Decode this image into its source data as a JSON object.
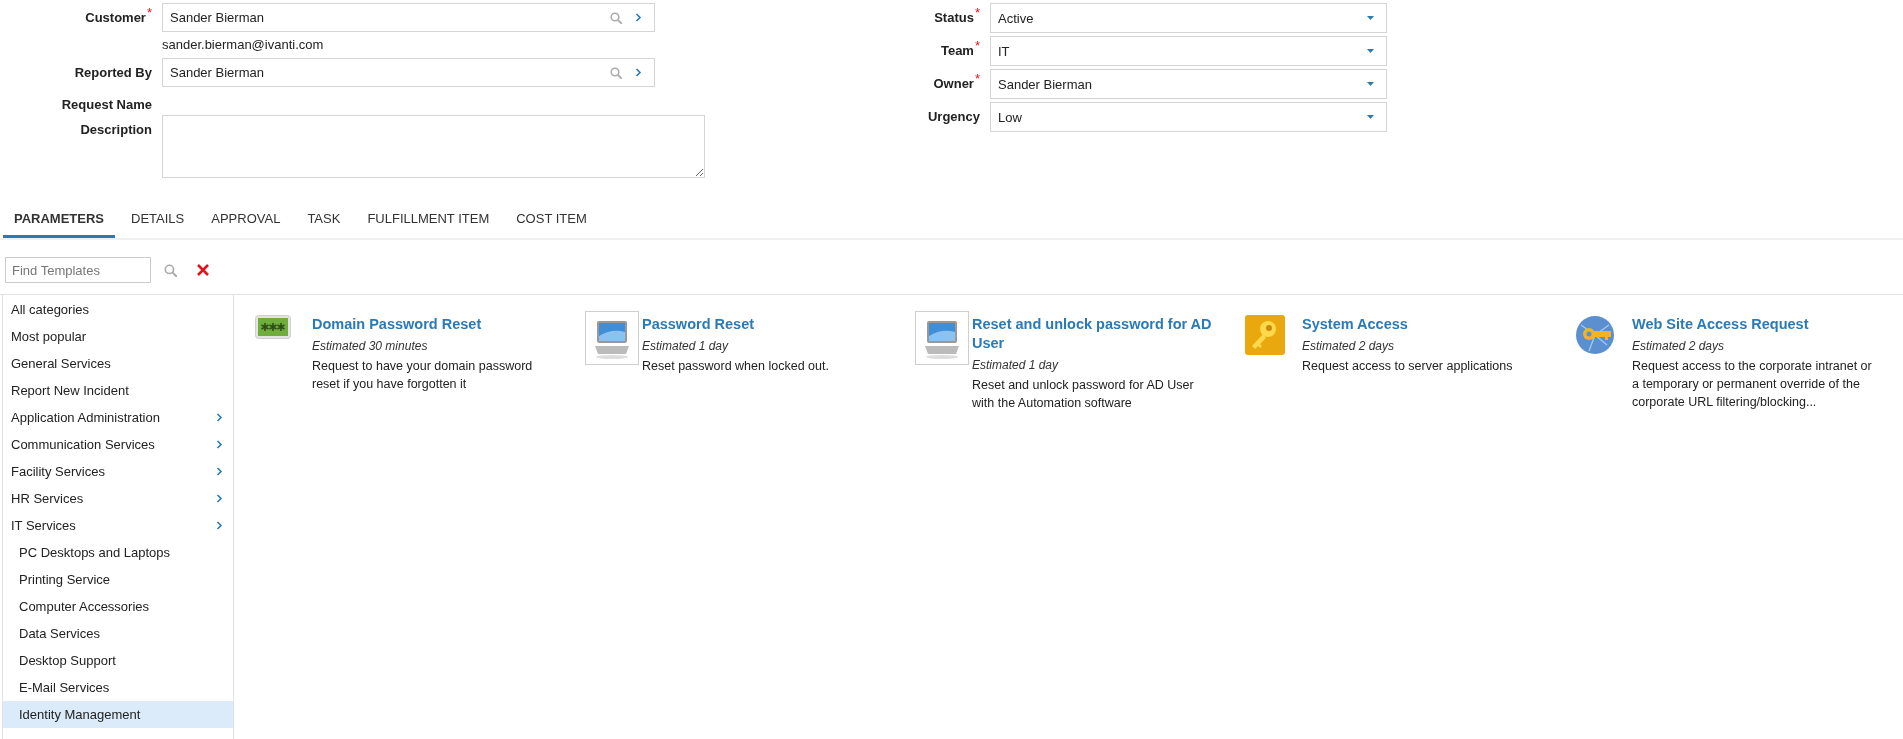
{
  "left_fields": [
    {
      "kind": "lookup",
      "label": "Customer",
      "required_mark": "*",
      "value": "Sander Bierman",
      "note": "sander.bierman@ivanti.com"
    },
    {
      "kind": "lookup",
      "label": "Reported By",
      "value": "Sander Bierman"
    },
    {
      "kind": "label",
      "label": "Request Name"
    },
    {
      "kind": "textarea",
      "label": "Description"
    }
  ],
  "right_fields": [
    {
      "label": "Status",
      "required_mark": "*",
      "value": "Active"
    },
    {
      "label": "Team",
      "required_mark": "*",
      "value": "IT"
    },
    {
      "label": "Owner",
      "required_mark": "*",
      "value": "Sander Bierman"
    },
    {
      "label": "Urgency",
      "value": "Low"
    }
  ],
  "tabs": [
    {
      "label": "PARAMETERS",
      "selected": true
    },
    {
      "label": "DETAILS",
      "selected": false
    },
    {
      "label": "APPROVAL",
      "selected": false
    },
    {
      "label": "TASK",
      "selected": false
    },
    {
      "label": "FULFILLMENT ITEM",
      "selected": false
    },
    {
      "label": "COST ITEM",
      "selected": false
    }
  ],
  "template_search": {
    "placeholder": "Find Templates"
  },
  "categories": [
    {
      "label": "All categories",
      "expandable": false,
      "selected": false
    },
    {
      "label": "Most popular",
      "expandable": false,
      "selected": false
    },
    {
      "label": "General Services",
      "expandable": false,
      "selected": false
    },
    {
      "label": "Report New Incident",
      "expandable": false,
      "selected": false
    },
    {
      "label": "Application Administration",
      "expandable": true,
      "selected": false
    },
    {
      "label": "Communication Services",
      "expandable": true,
      "selected": false
    },
    {
      "label": "Facility Services",
      "expandable": true,
      "selected": false
    },
    {
      "label": "HR Services",
      "expandable": true,
      "selected": false
    },
    {
      "label": "IT Services",
      "expandable": true,
      "selected": false,
      "children": [
        {
          "label": "PC Desktops and Laptops",
          "expandable": false,
          "selected": false
        },
        {
          "label": "Printing Service",
          "expandable": false,
          "selected": false
        },
        {
          "label": "Computer Accessories",
          "expandable": false,
          "selected": false
        },
        {
          "label": "Data Services",
          "expandable": false,
          "selected": false
        },
        {
          "label": "Desktop Support",
          "expandable": false,
          "selected": false
        },
        {
          "label": "E-Mail Services",
          "expandable": false,
          "selected": false
        },
        {
          "label": "Identity Management",
          "expandable": false,
          "selected": true
        }
      ]
    }
  ],
  "templates": [
    {
      "kind": "password",
      "title": "Domain Password Reset",
      "estimate": "Estimated 30 minutes",
      "description": "Request to have your domain password reset if you have forgotten it"
    },
    {
      "kind": "monitor",
      "title": "Password Reset",
      "estimate": "Estimated 1 day",
      "description": "Reset password when locked out."
    },
    {
      "kind": "monitor",
      "title": "Reset and unlock password for AD User",
      "estimate": "Estimated 1 day",
      "description": "Reset and unlock password for AD User with the Automation software"
    },
    {
      "kind": "key",
      "title": "System Access",
      "estimate": "Estimated 2 days",
      "description": "Request access to server applications"
    },
    {
      "kind": "globe-key",
      "title": "Web Site Access Request",
      "estimate": "Estimated 2 days",
      "description": "Request access to the corporate intranet or a temporary or permanent override of the corporate URL filtering/blocking..."
    }
  ]
}
